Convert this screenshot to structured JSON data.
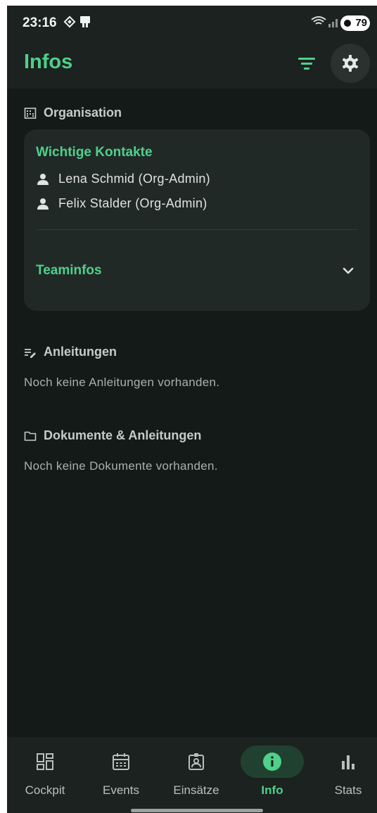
{
  "status": {
    "time": "23:16",
    "battery": "79"
  },
  "header": {
    "title": "Infos"
  },
  "organisation": {
    "heading": "Organisation",
    "card_title": "Wichtige Kontakte",
    "contacts": [
      "Lena Schmid (Org-Admin)",
      "Felix Stalder (Org-Admin)"
    ],
    "team_label": "Teaminfos"
  },
  "guides": {
    "heading": "Anleitungen",
    "empty": "Noch keine Anleitungen vorhanden."
  },
  "documents": {
    "heading": "Dokumente & Anleitungen",
    "empty": "Noch keine Dokumente vorhanden."
  },
  "nav": {
    "items": [
      {
        "label": "Cockpit",
        "icon": "dashboard-icon"
      },
      {
        "label": "Events",
        "icon": "calendar-icon"
      },
      {
        "label": "Einsätze",
        "icon": "badge-icon"
      },
      {
        "label": "Info",
        "icon": "info-icon",
        "active": true
      },
      {
        "label": "Stats",
        "icon": "bar-chart-icon"
      }
    ]
  },
  "colors": {
    "accent": "#4fd08b",
    "background": "#141a17",
    "card": "#212926"
  }
}
